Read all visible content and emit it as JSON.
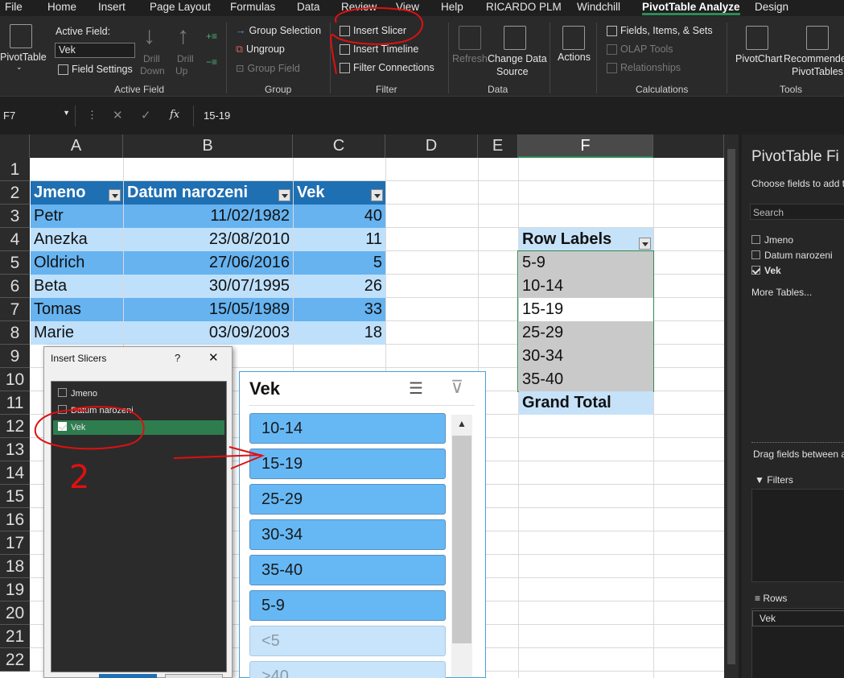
{
  "menu": {
    "tabs": [
      "File",
      "Home",
      "Insert",
      "Page Layout",
      "Formulas",
      "Data",
      "Review",
      "View",
      "Help",
      "RICARDO PLM",
      "Windchill",
      "PivotTable Analyze",
      "Design"
    ],
    "active": "PivotTable Analyze"
  },
  "ribbon": {
    "pivottable_label": "PivotTable",
    "active_field_label": "Active Field:",
    "active_field_value": "Vek",
    "field_settings": "Field Settings",
    "drill_down": "Drill Down",
    "drill_down_l1": "Drill",
    "drill_down_l2": "Down",
    "drill_up_l1": "Drill",
    "drill_up_l2": "Up",
    "group_active_field": "Active Field",
    "group_selection": "Group Selection",
    "ungroup": "Ungroup",
    "group_field": "Group Field",
    "group_group": "Group",
    "insert_slicer": "Insert Slicer",
    "insert_timeline": "Insert Timeline",
    "filter_connections": "Filter Connections",
    "group_filter": "Filter",
    "refresh": "Refresh",
    "change_data_source_l1": "Change Data",
    "change_data_source_l2": "Source",
    "group_data": "Data",
    "actions": "Actions",
    "fields_items_sets": "Fields, Items, & Sets",
    "olap_tools": "OLAP Tools",
    "relationships": "Relationships",
    "group_calculations": "Calculations",
    "pivotchart": "PivotChart",
    "recommended_l1": "Recommended",
    "recommended_l2": "PivotTables",
    "group_tools": "Tools"
  },
  "formula_bar": {
    "name_box": "F7",
    "fx": "fx",
    "value": "15-19"
  },
  "columns": [
    "A",
    "B",
    "C",
    "D",
    "E",
    "F"
  ],
  "rows": [
    "1",
    "2",
    "3",
    "4",
    "5",
    "6",
    "7",
    "8",
    "9",
    "10",
    "11",
    "12",
    "13",
    "14",
    "15",
    "16",
    "17",
    "18",
    "19",
    "20",
    "21",
    "22"
  ],
  "table": {
    "headers": [
      "Jmeno",
      "Datum narozeni",
      "Vek"
    ],
    "rows": [
      [
        "Petr",
        "11/02/1982",
        "40"
      ],
      [
        "Anezka",
        "23/08/2010",
        "11"
      ],
      [
        "Oldrich",
        "27/06/2016",
        "5"
      ],
      [
        "Beta",
        "30/07/1995",
        "26"
      ],
      [
        "Tomas",
        "15/05/1989",
        "33"
      ],
      [
        "Marie",
        "03/09/2003",
        "18"
      ]
    ]
  },
  "pivot": {
    "row_labels": "Row Labels",
    "items": [
      "5-9",
      "10-14",
      "15-19",
      "25-29",
      "30-34",
      "35-40"
    ],
    "grand_total": "Grand Total"
  },
  "dialog": {
    "title": "Insert Slicers",
    "help": "?",
    "close": "✕",
    "fields": [
      "Jmeno",
      "Datum narozeni",
      "Vek"
    ],
    "checked": [
      false,
      false,
      true
    ]
  },
  "slicer": {
    "title": "Vek",
    "items": [
      "10-14",
      "15-19",
      "25-29",
      "30-34",
      "35-40",
      "5-9",
      "<5",
      ">40"
    ],
    "nodata": [
      false,
      false,
      false,
      false,
      false,
      false,
      true,
      true
    ]
  },
  "pane": {
    "title": "PivotTable Fi",
    "subtitle": "Choose fields to add t",
    "search_placeholder": "Search",
    "fields": [
      "Jmeno",
      "Datum narozeni",
      "Vek"
    ],
    "checked": [
      false,
      false,
      true
    ],
    "more_tables": "More Tables...",
    "drag_text": "Drag fields between a",
    "filters": "Filters",
    "rows": "Rows",
    "rows_value": "Vek"
  },
  "annotation": {
    "number": "2",
    "color": "#e01010"
  }
}
